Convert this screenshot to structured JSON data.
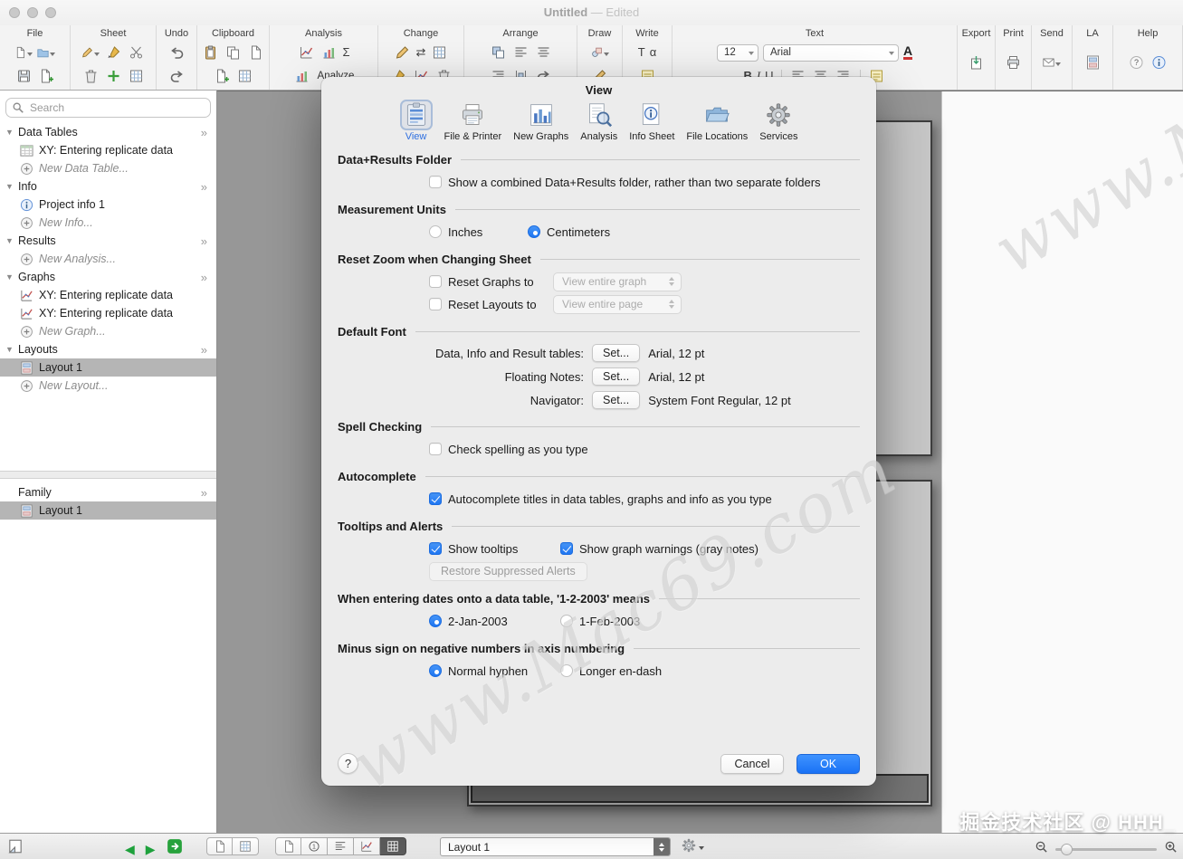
{
  "window": {
    "title_name": "Untitled ",
    "title_suffix": "— Edited"
  },
  "icons": {
    "dropdown_caret": "▾",
    "disclosure_open": "▼",
    "section_chevrons": "»",
    "prev_arrow": "◀",
    "next_arrow": "▶",
    "swap_arrows": "⇄",
    "sigma": "Σ",
    "alpha": "α",
    "text_tool": "T",
    "bold": "B",
    "italic": "I",
    "underline": "U",
    "font_color": "A"
  },
  "toolbar": {
    "sections": [
      {
        "label": "File"
      },
      {
        "label": "Sheet"
      },
      {
        "label": "Undo"
      },
      {
        "label": "Clipboard"
      },
      {
        "label": "Analysis",
        "analyze_label": "Analyze"
      },
      {
        "label": "Change"
      },
      {
        "label": "Arrange"
      },
      {
        "label": "Draw"
      },
      {
        "label": "Write"
      },
      {
        "label": "Text",
        "font_size": "12",
        "font_name": "Arial"
      },
      {
        "label": "Export"
      },
      {
        "label": "Print"
      },
      {
        "label": "Send"
      },
      {
        "label": "LA"
      },
      {
        "label": "Help"
      }
    ]
  },
  "sidebar": {
    "search_placeholder": "Search",
    "sections": [
      {
        "label": "Data Tables",
        "items": [
          {
            "label": "XY: Entering replicate data"
          },
          {
            "label": "New Data Table..."
          }
        ]
      },
      {
        "label": "Info",
        "items": [
          {
            "label": "Project info 1"
          },
          {
            "label": "New Info..."
          }
        ]
      },
      {
        "label": "Results",
        "items": [
          {
            "label": "New Analysis..."
          }
        ]
      },
      {
        "label": "Graphs",
        "items": [
          {
            "label": "XY: Entering replicate data"
          },
          {
            "label": "XY: Entering replicate data"
          },
          {
            "label": "New Graph..."
          }
        ]
      },
      {
        "label": "Layouts",
        "items": [
          {
            "label": "Layout 1"
          },
          {
            "label": "New Layout..."
          }
        ]
      }
    ],
    "family": {
      "label": "Family",
      "item": "Layout 1"
    }
  },
  "dialog": {
    "title": "View",
    "tabs": [
      "View",
      "File & Printer",
      "New Graphs",
      "Analysis",
      "Info Sheet",
      "File Locations",
      "Services"
    ],
    "data_results": {
      "heading": "Data+Results Folder",
      "checkbox_label": "Show a combined Data+Results folder, rather than two separate folders"
    },
    "units": {
      "heading": "Measurement Units",
      "inches": "Inches",
      "centimeters": "Centimeters",
      "selected": "Centimeters"
    },
    "reset_zoom": {
      "heading": "Reset Zoom when Changing Sheet",
      "graphs_label": "Reset Graphs to",
      "graphs_value": "View entire graph",
      "layouts_label": "Reset Layouts to",
      "layouts_value": "View entire page"
    },
    "default_font": {
      "heading": "Default Font",
      "set_label": "Set...",
      "rows": [
        {
          "label": "Data, Info and Result tables:",
          "value": "Arial, 12 pt"
        },
        {
          "label": "Floating Notes:",
          "value": "Arial, 12 pt"
        },
        {
          "label": "Navigator:",
          "value": "System Font Regular, 12 pt"
        }
      ]
    },
    "spell": {
      "heading": "Spell Checking",
      "checkbox_label": "Check spelling as you type"
    },
    "autocomplete": {
      "heading": "Autocomplete",
      "checkbox_label": "Autocomplete titles in data tables, graphs and info as you type"
    },
    "tooltips": {
      "heading": "Tooltips and Alerts",
      "show_tooltips": "Show tooltips",
      "show_warnings": "Show graph warnings (gray notes)",
      "restore_button": "Restore Suppressed Alerts"
    },
    "dates": {
      "heading": "When entering dates onto a data table, '1-2-2003' means",
      "option1": "2-Jan-2003",
      "option2": "1-Feb-2003",
      "selected": "2-Jan-2003"
    },
    "minus": {
      "heading": "Minus sign on negative numbers in axis numbering",
      "option1": "Normal hyphen",
      "option2": "Longer en-dash",
      "selected": "Normal hyphen"
    },
    "footer": {
      "help": "?",
      "cancel": "Cancel",
      "ok": "OK"
    }
  },
  "statusbar": {
    "sheet_selector": "Layout 1"
  },
  "watermark": {
    "text": "www.Mac69.com",
    "credit": "掘金技术社区 @ HHH_"
  },
  "colors": {
    "accent_blue": "#1f76f2",
    "ok_button": "#1a72f5",
    "selected_row": "#b5b5b5",
    "canvas_gray": "#979797"
  }
}
